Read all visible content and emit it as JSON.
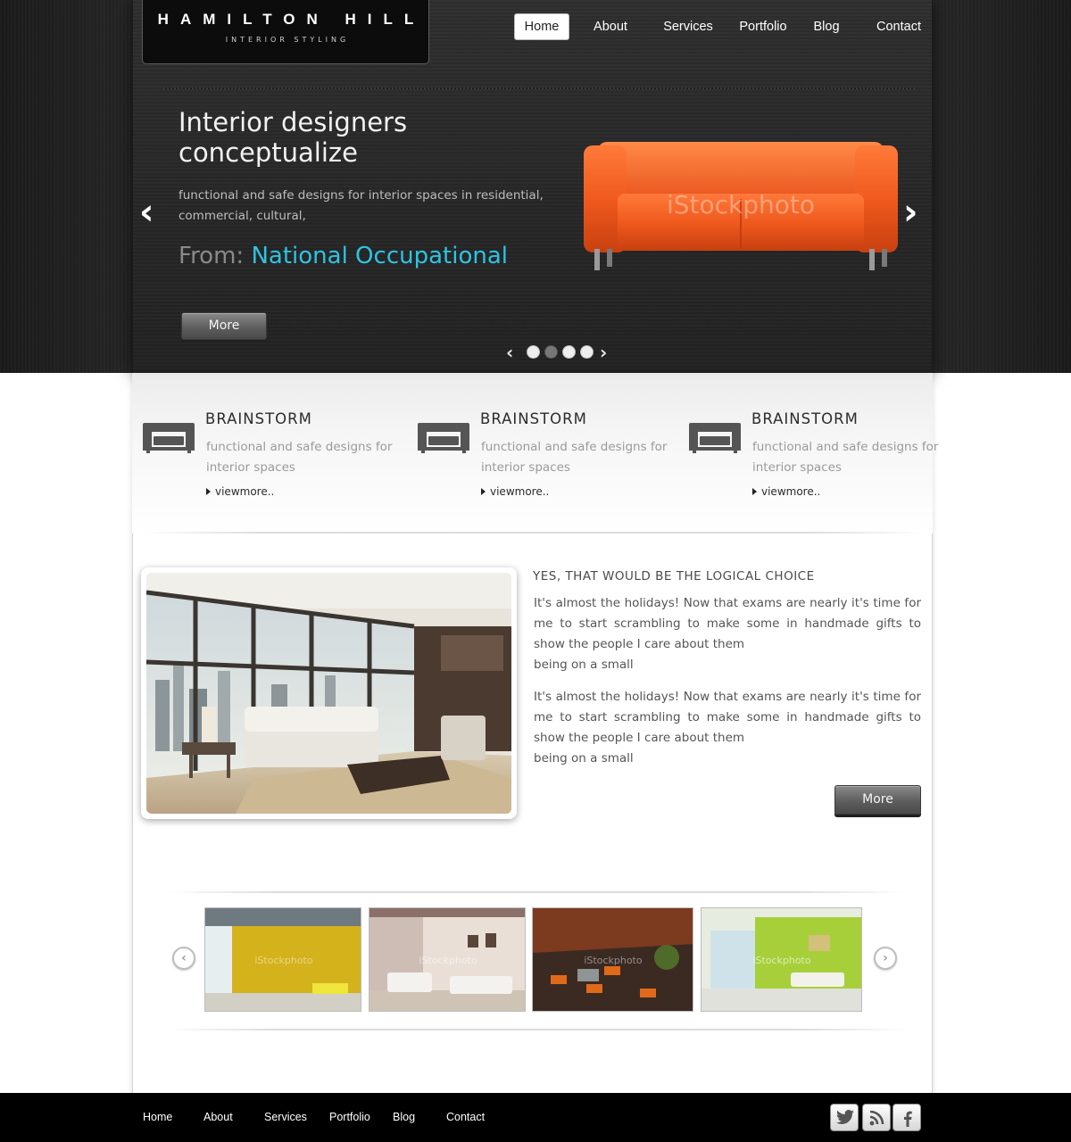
{
  "brand": {
    "name": "HAMILTON HILL",
    "tagline": "INTERIOR STYLING"
  },
  "nav": {
    "items": [
      {
        "label": "Home",
        "active": true
      },
      {
        "label": "About"
      },
      {
        "label": "Services"
      },
      {
        "label": "Portfolio"
      },
      {
        "label": "Blog"
      },
      {
        "label": "Contact"
      }
    ]
  },
  "hero": {
    "title": "Interior designers conceptualize",
    "description": "functional and safe designs for interior spaces in residential, commercial, cultural,",
    "from_label": "From:",
    "from_value": "National Occupational",
    "more_label": "More",
    "image_watermark": "iStockphoto",
    "slides": 4,
    "active_slide": 2,
    "prev_icon": "chevron-left-icon",
    "next_icon": "chevron-right-icon"
  },
  "features": [
    {
      "title": "BRAINSTORM",
      "text": "functional and safe designs for interior spaces",
      "link": "viewmore..",
      "icon": "sofa-icon"
    },
    {
      "title": "BRAINSTORM",
      "text": "functional and safe designs for interior spaces",
      "link": "viewmore..",
      "icon": "sofa-icon"
    },
    {
      "title": "BRAINSTORM",
      "text": "functional and safe designs for interior spaces",
      "link": "viewmore..",
      "icon": "sofa-icon"
    }
  ],
  "article": {
    "title": "YES, THAT WOULD BE THE LOGICAL CHOICE",
    "paragraphs": [
      {
        "body": "It's almost the holidays! Now that exams are nearly it's time for me to start scrambling to make some in handmade gifts to show the people I care about them",
        "tail": "being on a small"
      },
      {
        "body": "It's almost the holidays! Now that exams are nearly it's time for me to start scrambling to make some in handmade gifts to show the people I care about them",
        "tail": "being on a small"
      }
    ],
    "more_label": "More"
  },
  "gallery": {
    "watermark": "iStockphoto",
    "thumbnails": 4,
    "prev_icon": "circle-chevron-left-icon",
    "next_icon": "circle-chevron-right-icon"
  },
  "footer": {
    "links": [
      "Home",
      "About",
      "Services",
      "Portfolio",
      "Blog",
      "Contact"
    ],
    "social": [
      "twitter-icon",
      "rss-icon",
      "facebook-icon"
    ]
  },
  "colors": {
    "accent": "#2ec3e2",
    "sofa": "#f05a1e",
    "dark_bg": "#262626",
    "footer_bg": "#000000"
  }
}
